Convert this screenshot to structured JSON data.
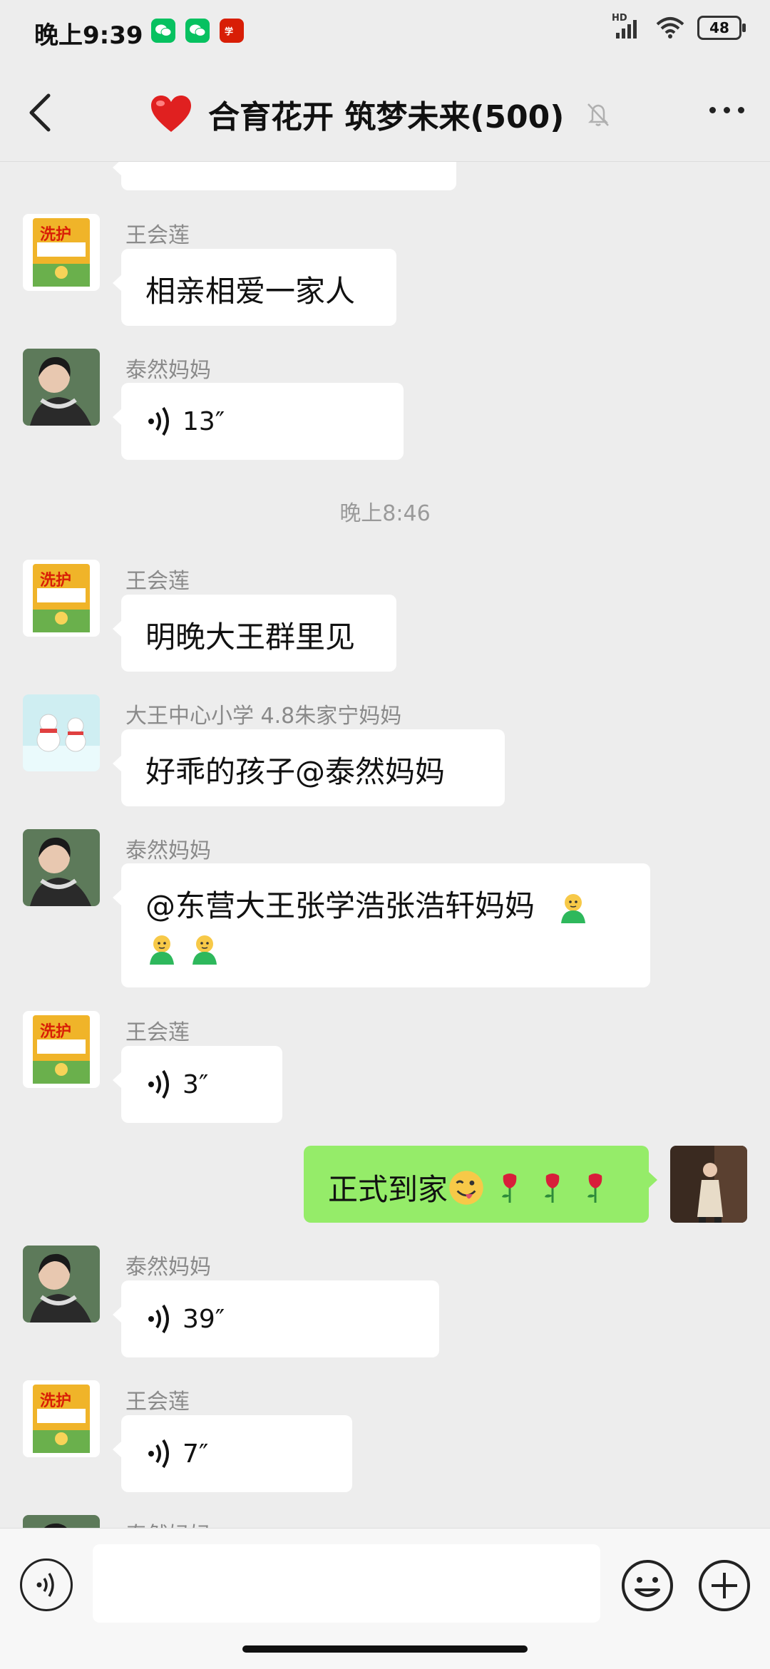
{
  "status_bar": {
    "time": "晚上9:39",
    "apps": [
      "wechat-icon",
      "wechat-icon",
      "xuexi-icon"
    ],
    "app_colors": [
      "#07c160",
      "#07c160",
      "#d81e06"
    ],
    "signal_label": "HD",
    "battery": "48"
  },
  "header": {
    "title": "合育花开 筑梦未来(500)",
    "heart_color": "#e02020",
    "muted": true
  },
  "chat": {
    "timestamp": "晚上8:46",
    "messages": [
      {
        "sender": "王会莲",
        "type": "text",
        "text": "相亲相爱一家人"
      },
      {
        "sender": "泰然妈妈",
        "type": "voice",
        "duration": "13″"
      },
      {
        "sender": "王会莲",
        "type": "text",
        "text": "明晚大王群里见"
      },
      {
        "sender": "大王中心小学 4.8朱家宁妈妈",
        "type": "text",
        "text": "好乖的孩子@泰然妈妈"
      },
      {
        "sender": "泰然妈妈",
        "type": "text",
        "text_line1": "@东营大王张学浩张浩轩妈妈",
        "emojis": [
          "shrug-figure-emoji",
          "shrug-figure-emoji",
          "shrug-figure-emoji"
        ]
      },
      {
        "sender": "王会莲",
        "type": "voice",
        "duration": "3″"
      },
      {
        "sender": "me",
        "type": "text",
        "text": "正式到家",
        "emojis": [
          "wink-tongue-emoji",
          "rose-emoji",
          "rose-emoji",
          "rose-emoji"
        ]
      },
      {
        "sender": "泰然妈妈",
        "type": "voice",
        "duration": "39″"
      },
      {
        "sender": "王会莲",
        "type": "voice",
        "duration": "7″"
      },
      {
        "sender": "泰然妈妈",
        "type": "partial"
      }
    ]
  },
  "input": {
    "placeholder": ""
  },
  "colors": {
    "my_bubble": "#95ec69",
    "background": "#ededed"
  }
}
